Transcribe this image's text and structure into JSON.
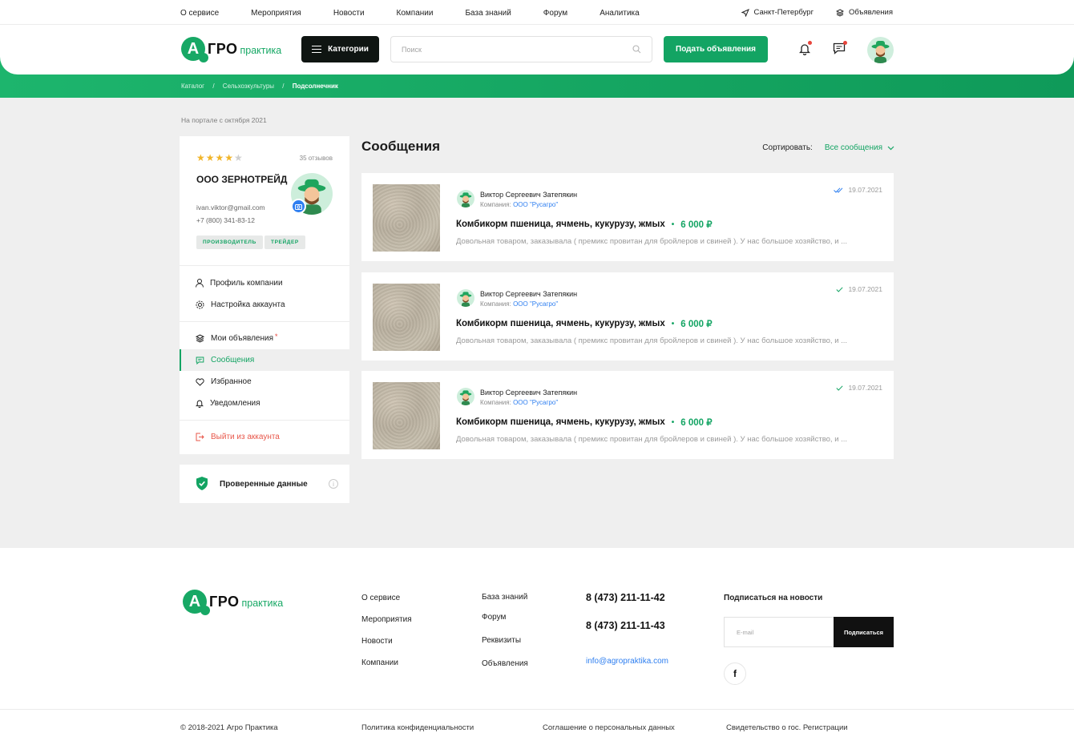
{
  "topnav": {
    "links": [
      "О сервисе",
      "Мероприятия",
      "Новости",
      "Компании",
      "База знаний",
      "Форум",
      "Аналитика"
    ],
    "city": "Санкт-Петербург",
    "ads": "Объявления"
  },
  "logo": {
    "letter": "А",
    "word1": "ГРО",
    "word2": "практика"
  },
  "header": {
    "categories_label": "Категории",
    "search_placeholder": "Поиск",
    "post_label": "Подать объявления"
  },
  "breadcrumb": [
    "Каталог",
    "Сельхозкультуры",
    "Подсолнечник"
  ],
  "since": "На портале с октября 2021",
  "profile": {
    "rating": 4,
    "reviews": "35 отзывов",
    "company": "ООО ЗЕРНОТРЕЙД",
    "email": "ivan.viktor@gmail.com",
    "phone": "+7 (800) 341-83-12",
    "tags": [
      "ПРОИЗВОДИТЕЛЬ",
      "ТРЕЙДЕР"
    ]
  },
  "menu": {
    "profile": "Профиль компании",
    "settings": "Настройка аккаунта",
    "my_ads": "Мои объявления",
    "messages": "Сообщения",
    "favorites": "Избранное",
    "notifications": "Уведомления",
    "logout": "Выйти из аккаунта"
  },
  "verified": "Проверенные данные",
  "main": {
    "title": "Сообщения",
    "sort_label": "Сортировать:",
    "sort_value": "Все сообщения"
  },
  "messages": [
    {
      "user": "Виктор Сергеевич Затепякин",
      "company_label": "Компания:",
      "company": "ООО \"Русагро\"",
      "date": "19.07.2021",
      "read": "double",
      "title": "Комбикорм пшеница, ячмень, кукурузу, жмых",
      "price": "6 000 ₽",
      "text": "Довольная товаром, заказывала ( премикс провитан для бройлеров и свиней ). У нас большое хозяйство, и ..."
    },
    {
      "user": "Виктор Сергеевич Затепякин",
      "company_label": "Компания:",
      "company": "ООО \"Русагро\"",
      "date": "19.07.2021",
      "read": "single",
      "title": "Комбикорм пшеница, ячмень, кукурузу, жмых",
      "price": "6 000 ₽",
      "text": "Довольная товаром, заказывала ( премикс провитан для бройлеров и свиней ). У нас большое хозяйство, и ..."
    },
    {
      "user": "Виктор Сергеевич Затепякин",
      "company_label": "Компания:",
      "company": "ООО \"Русагро\"",
      "date": "19.07.2021",
      "read": "single",
      "title": "Комбикорм пшеница, ячмень, кукурузу, жмых",
      "price": "6 000 ₽",
      "text": "Довольная товаром, заказывала ( премикс провитан для бройлеров и свиней ). У нас большое хозяйство, и ..."
    }
  ],
  "footer": {
    "col1": [
      "О сервисе",
      "Мероприятия",
      "Новости",
      "Компании"
    ],
    "col2": [
      "База знаний",
      "Форум",
      "Реквизиты",
      "Объявления"
    ],
    "phones": [
      "8 (473) 211-11-42",
      "8 (473) 211-11-43"
    ],
    "email": "info@agropraktika.com",
    "subscribe_title": "Подписаться на новости",
    "email_placeholder": "E-mail",
    "subscribe_button": "Подписаться",
    "social": "f",
    "bottom": [
      "© 2018-2021 Агро Практика",
      "Политика конфиденциальности",
      "Соглашение о персональных данных",
      "Свидетельство о гос. Регистрации"
    ]
  },
  "colors": {
    "accent": "#13a463",
    "dark": "#0f1512",
    "link": "#2d7ef0",
    "danger": "#e8574a",
    "star": "#f1b52a"
  }
}
